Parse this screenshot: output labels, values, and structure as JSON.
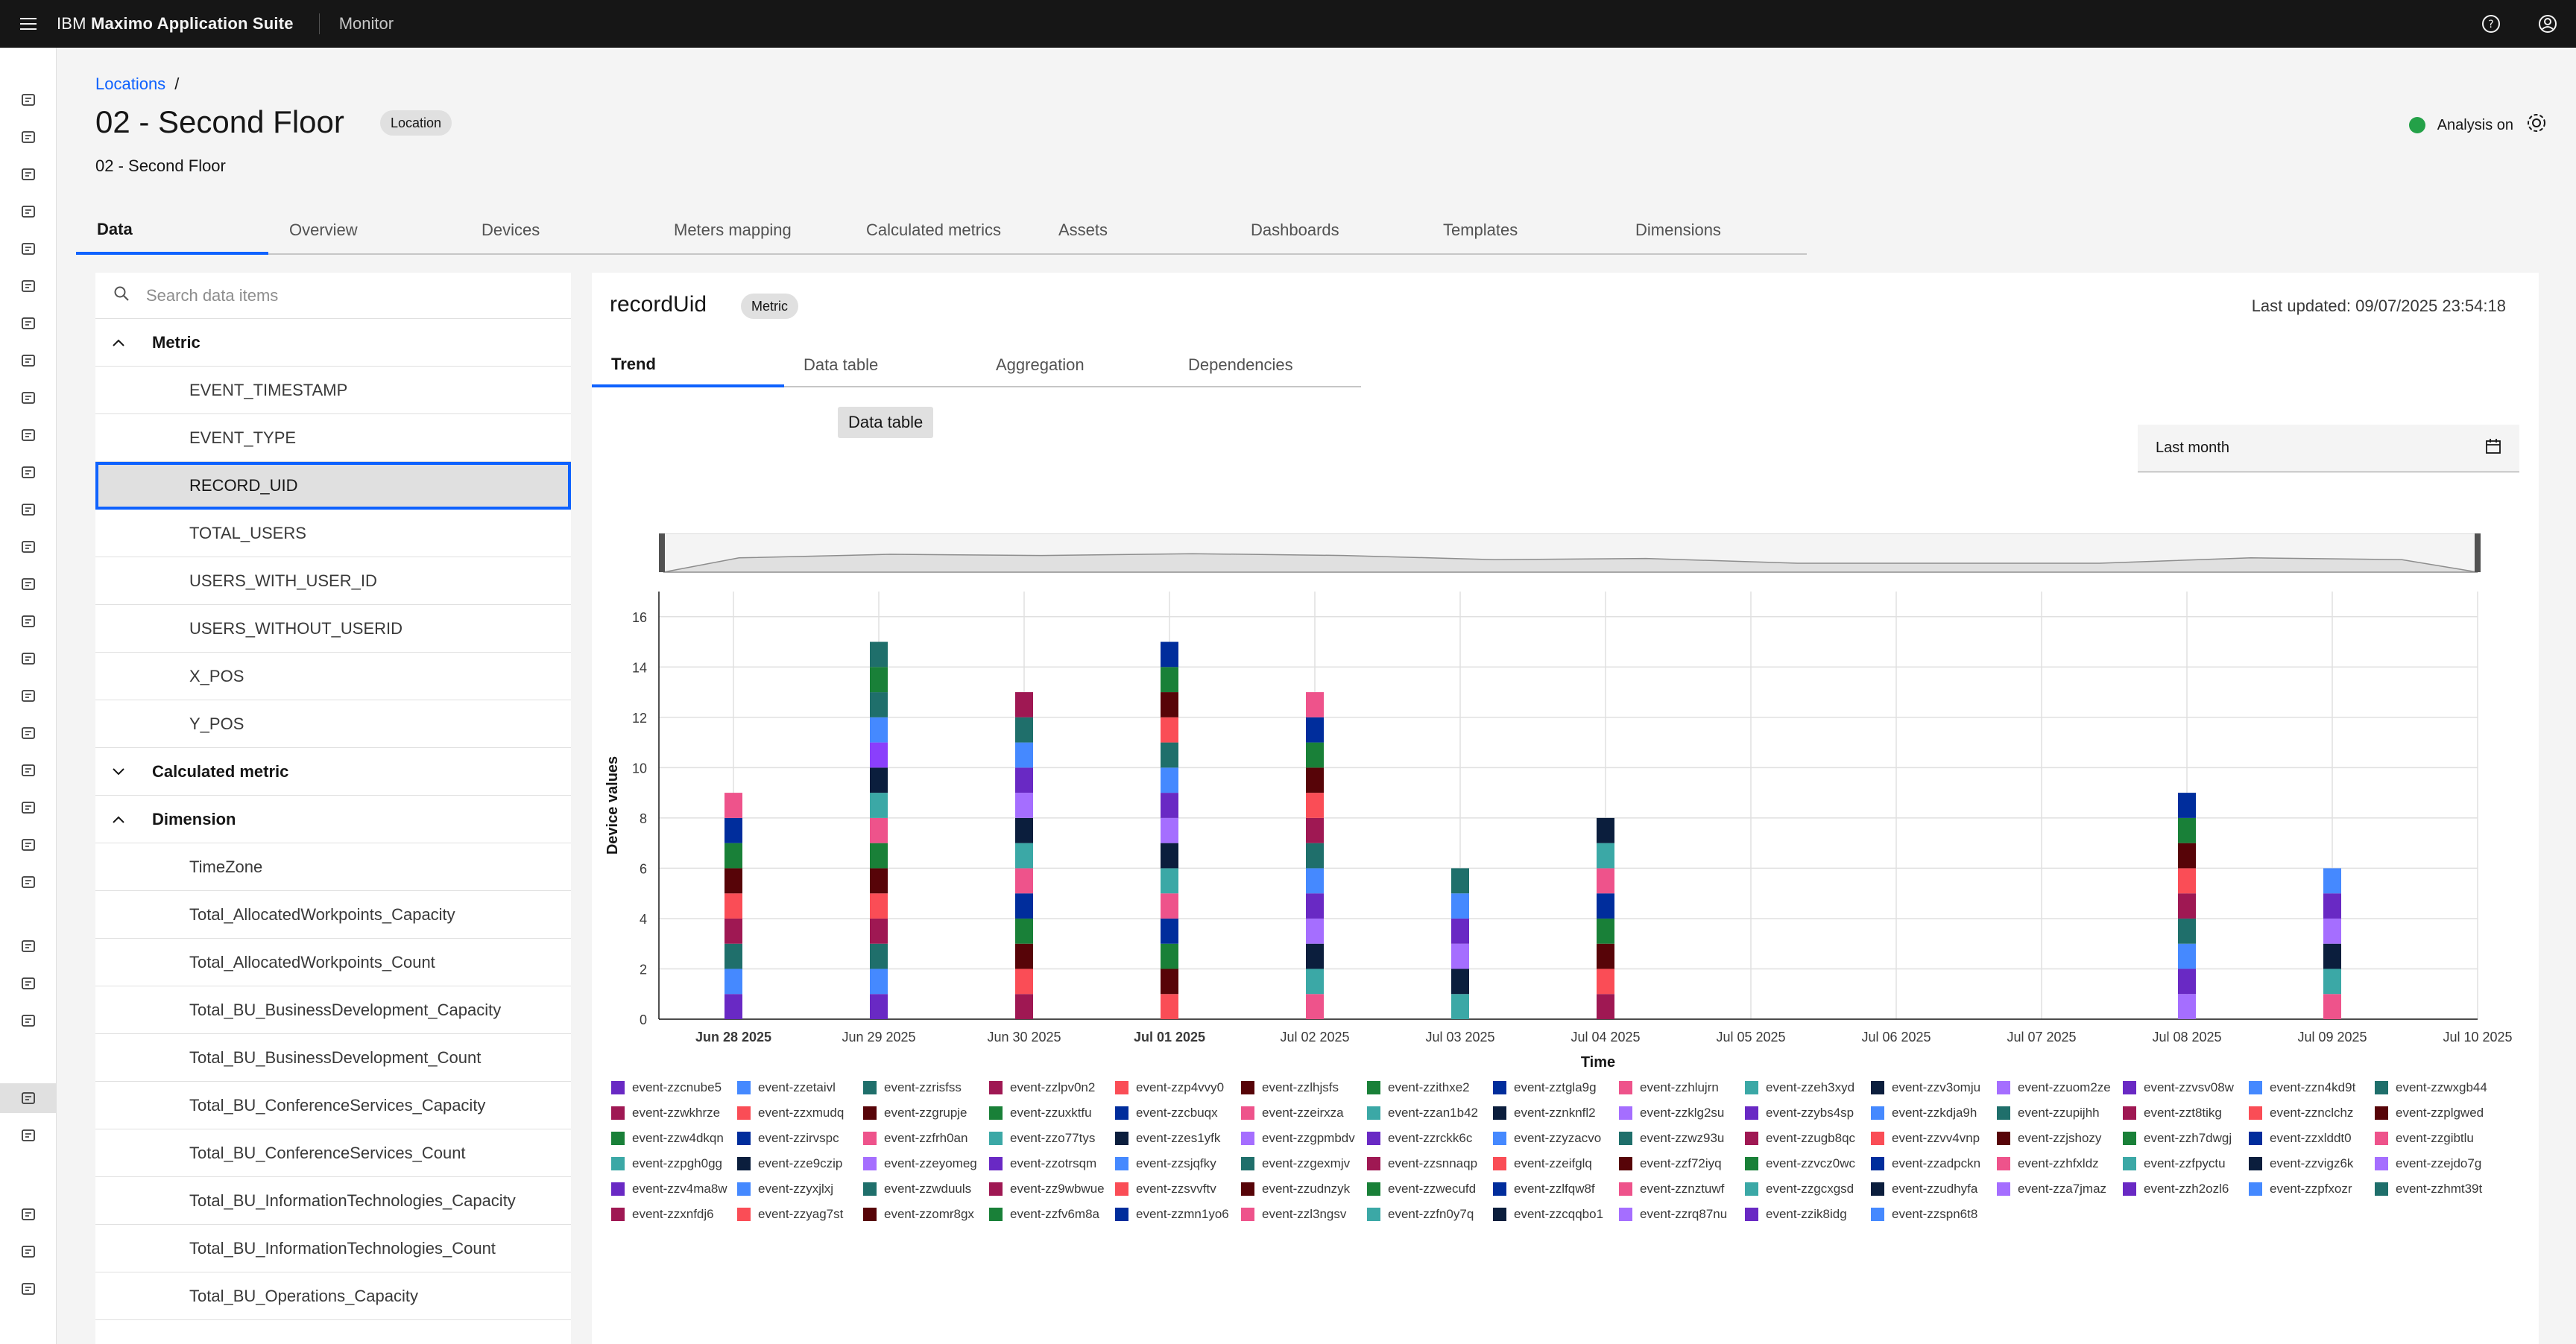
{
  "header": {
    "brand_prefix": "IBM ",
    "brand_name": "Maximo Application Suite",
    "app_name": "Monitor",
    "menu_icon": "hamburger-icon",
    "help_icon": "help-icon",
    "user_icon": "user-avatar-icon"
  },
  "sidenav": {
    "icons": [
      "user-icon",
      "bar-chart-icon",
      "rocket-icon",
      "tree-icon",
      "clipboard-check-icon",
      "report-icon",
      "line-chart-icon",
      "monitor-icon",
      "grid-icon",
      "briefcase-icon",
      "network-icon",
      "dashboard-icon",
      "shield-icon",
      "checklist-icon",
      "clipboard-icon",
      "lock-icon",
      "cart-icon",
      "handshake-icon",
      "hierarchy-icon",
      "sliders-icon",
      "task-icon",
      "document-icon",
      "list-check-icon",
      "gauge-icon",
      "org-chart-icon",
      "table-icon",
      "data-structure-icon",
      "phone-icon",
      "settings-alert-icon",
      "settings-icon"
    ],
    "active_index": 25
  },
  "page": {
    "breadcrumb": "Locations",
    "breadcrumb_sep": "/",
    "title": "02 - Second Floor",
    "title_tag": "Location",
    "subtitle": "02 - Second Floor",
    "analysis_label": "Analysis on",
    "tabs": [
      "Data",
      "Overview",
      "Devices",
      "Meters mapping",
      "Calculated metrics",
      "Assets",
      "Dashboards",
      "Templates",
      "Dimensions"
    ]
  },
  "left": {
    "search_placeholder": "Search data items",
    "groups": [
      {
        "label": "Metric",
        "expanded": true,
        "items": [
          "EVENT_TIMESTAMP",
          "EVENT_TYPE",
          "RECORD_UID",
          "TOTAL_USERS",
          "USERS_WITH_USER_ID",
          "USERS_WITHOUT_USERID",
          "X_POS",
          "Y_POS"
        ]
      },
      {
        "label": "Calculated metric",
        "expanded": false,
        "items": []
      },
      {
        "label": "Dimension",
        "expanded": true,
        "items": [
          "TimeZone",
          "Total_AllocatedWorkpoints_Capacity",
          "Total_AllocatedWorkpoints_Count",
          "Total_BU_BusinessDevelopment_Capacity",
          "Total_BU_BusinessDevelopment_Count",
          "Total_BU_ConferenceServices_Capacity",
          "Total_BU_ConferenceServices_Count",
          "Total_BU_InformationTechnologies_Capacity",
          "Total_BU_InformationTechnologies_Count",
          "Total_BU_Operations_Capacity"
        ]
      }
    ],
    "selected": "RECORD_UID"
  },
  "right": {
    "title": "recordUid",
    "tag": "Metric",
    "last_updated": "Last updated: 09/07/2025 23:54:18",
    "subtabs": [
      "Trend",
      "Data table",
      "Aggregation",
      "Dependencies"
    ],
    "tooltip": "Data table",
    "date_range": "Last month"
  },
  "chart_data": {
    "type": "bar",
    "stacked": true,
    "xlabel": "Time",
    "ylabel": "Device values",
    "ylim": [
      0,
      17
    ],
    "y_ticks": [
      0,
      2,
      4,
      6,
      8,
      10,
      12,
      14,
      16
    ],
    "x_ticks": [
      "Jun 28 2025",
      "Jun 29 2025",
      "Jun 30 2025",
      "Jul 01 2025",
      "Jul 02 2025",
      "Jul 03 2025",
      "Jul 04 2025",
      "Jul 05 2025",
      "Jul 06 2025",
      "Jul 07 2025",
      "Jul 08 2025",
      "Jul 09 2025",
      "Jul 10 2025"
    ],
    "bold_ticks": [
      "Jun 28 2025",
      "Jul 01 2025"
    ],
    "categories": [
      "Jun 28 2025",
      "Jun 29 2025",
      "Jun 30 2025",
      "Jul 01 2025",
      "Jul 02 2025",
      "Jul 03 2025",
      "Jul 04 2025",
      "Jul 05 2025",
      "Jul 06 2025",
      "Jul 07 2025",
      "Jul 08 2025",
      "Jul 09 2025"
    ],
    "totals": [
      9,
      15,
      13,
      16,
      13,
      6,
      8,
      0,
      0,
      0,
      9,
      6
    ],
    "segment_colors": [
      [
        "#6929c4",
        "#4589ff",
        "#1f6f6b",
        "#9f1853",
        "#fa4d56",
        "#570408",
        "#198038",
        "#002d9c",
        "#ee538b"
      ],
      [
        "#6929c4",
        "#4589ff",
        "#1f6f6b",
        "#9f1853",
        "#fa4d56",
        "#570408",
        "#198038",
        "#ee538b",
        "#3ba8a6",
        "#0b1e3d",
        "#8a3ffc",
        "#4589ff",
        "#1f6f6b",
        "#198038",
        "#1f6f6b"
      ],
      [
        "#9f1853",
        "#fa4d56",
        "#570408",
        "#198038",
        "#002d9c",
        "#ee538b",
        "#3ba8a6",
        "#0b1e3d",
        "#a56eff",
        "#6929c4",
        "#4589ff",
        "#1f6f6b",
        "#9f1853"
      ],
      [
        "#fa4d56",
        "#570408",
        "#198038",
        "#002d9c",
        "#ee538b",
        "#3ba8a6",
        "#0b1e3d",
        "#a56eff",
        "#6929c4",
        "#4589ff",
        "#1f6f6b",
        "#fa4d56",
        "#570408",
        "#198038",
        "#002d9c"
      ],
      [
        "#ee538b",
        "#3ba8a6",
        "#0b1e3d",
        "#a56eff",
        "#6929c4",
        "#4589ff",
        "#1f6f6b",
        "#9f1853",
        "#fa4d56",
        "#570408",
        "#198038",
        "#002d9c",
        "#ee538b"
      ],
      [
        "#3ba8a6",
        "#0b1e3d",
        "#a56eff",
        "#6929c4",
        "#4589ff",
        "#1f6f6b"
      ],
      [
        "#9f1853",
        "#fa4d56",
        "#570408",
        "#198038",
        "#002d9c",
        "#ee538b",
        "#3ba8a6",
        "#0b1e3d"
      ],
      [],
      [],
      [],
      [
        "#a56eff",
        "#6929c4",
        "#4589ff",
        "#1f6f6b",
        "#9f1853",
        "#fa4d56",
        "#570408",
        "#198038",
        "#002d9c"
      ],
      [
        "#ee538b",
        "#3ba8a6",
        "#0b1e3d",
        "#a56eff",
        "#6929c4",
        "#4589ff"
      ]
    ],
    "legend": [
      {
        "name": "event-zzcnube5",
        "color": "#6929c4"
      },
      {
        "name": "event-zzetaivl",
        "color": "#4589ff"
      },
      {
        "name": "event-zzrisfss",
        "color": "#1f6f6b"
      },
      {
        "name": "event-zzlpv0n2",
        "color": "#9f1853"
      },
      {
        "name": "event-zzp4vvy0",
        "color": "#fa4d56"
      },
      {
        "name": "event-zzlhjsfs",
        "color": "#570408"
      },
      {
        "name": "event-zzithxe2",
        "color": "#198038"
      },
      {
        "name": "event-zztgla9g",
        "color": "#002d9c"
      },
      {
        "name": "event-zzhlujrn",
        "color": "#ee538b"
      },
      {
        "name": "event-zzeh3xyd",
        "color": "#3ba8a6"
      },
      {
        "name": "event-zzv3omju",
        "color": "#0b1e3d"
      },
      {
        "name": "event-zzuom2ze",
        "color": "#a56eff"
      },
      {
        "name": "event-zzvsv08w",
        "color": "#6929c4"
      },
      {
        "name": "event-zzn4kd9t",
        "color": "#4589ff"
      },
      {
        "name": "event-zzwxgb44",
        "color": "#1f6f6b"
      },
      {
        "name": "event-zzwkhrze",
        "color": "#9f1853"
      },
      {
        "name": "event-zzxmudq",
        "color": "#fa4d56"
      },
      {
        "name": "event-zzgrupje",
        "color": "#570408"
      },
      {
        "name": "event-zzuxktfu",
        "color": "#198038"
      },
      {
        "name": "event-zzcbuqx",
        "color": "#002d9c"
      },
      {
        "name": "event-zzeirxza",
        "color": "#ee538b"
      },
      {
        "name": "event-zzan1b42",
        "color": "#3ba8a6"
      },
      {
        "name": "event-zznknfl2",
        "color": "#0b1e3d"
      },
      {
        "name": "event-zzklg2su",
        "color": "#a56eff"
      },
      {
        "name": "event-zzybs4sp",
        "color": "#6929c4"
      },
      {
        "name": "event-zzkdja9h",
        "color": "#4589ff"
      },
      {
        "name": "event-zzupijhh",
        "color": "#1f6f6b"
      },
      {
        "name": "event-zzt8tikg",
        "color": "#9f1853"
      },
      {
        "name": "event-zznclchz",
        "color": "#fa4d56"
      },
      {
        "name": "event-zzplgwed",
        "color": "#570408"
      },
      {
        "name": "event-zzw4dkqn",
        "color": "#198038"
      },
      {
        "name": "event-zzirvspc",
        "color": "#002d9c"
      },
      {
        "name": "event-zzfrh0an",
        "color": "#ee538b"
      },
      {
        "name": "event-zzo77tys",
        "color": "#3ba8a6"
      },
      {
        "name": "event-zzes1yfk",
        "color": "#0b1e3d"
      },
      {
        "name": "event-zzgpmbdv",
        "color": "#a56eff"
      },
      {
        "name": "event-zzrckk6c",
        "color": "#6929c4"
      },
      {
        "name": "event-zzyzacvo",
        "color": "#4589ff"
      },
      {
        "name": "event-zzwz93u",
        "color": "#1f6f6b"
      },
      {
        "name": "event-zzugb8qc",
        "color": "#9f1853"
      },
      {
        "name": "event-zzvv4vnp",
        "color": "#fa4d56"
      },
      {
        "name": "event-zzjshozy",
        "color": "#570408"
      },
      {
        "name": "event-zzh7dwgj",
        "color": "#198038"
      },
      {
        "name": "event-zzxlddt0",
        "color": "#002d9c"
      },
      {
        "name": "event-zzgibtlu",
        "color": "#ee538b"
      },
      {
        "name": "event-zzpgh0gg",
        "color": "#3ba8a6"
      },
      {
        "name": "event-zze9czip",
        "color": "#0b1e3d"
      },
      {
        "name": "event-zzeyomeg",
        "color": "#a56eff"
      },
      {
        "name": "event-zzotrsqm",
        "color": "#6929c4"
      },
      {
        "name": "event-zzsjqfky",
        "color": "#4589ff"
      },
      {
        "name": "event-zzgexmjv",
        "color": "#1f6f6b"
      },
      {
        "name": "event-zzsnnaqp",
        "color": "#9f1853"
      },
      {
        "name": "event-zzeifglq",
        "color": "#fa4d56"
      },
      {
        "name": "event-zzf72iyq",
        "color": "#570408"
      },
      {
        "name": "event-zzvcz0wc",
        "color": "#198038"
      },
      {
        "name": "event-zzadpckn",
        "color": "#002d9c"
      },
      {
        "name": "event-zzhfxldz",
        "color": "#ee538b"
      },
      {
        "name": "event-zzfpyctu",
        "color": "#3ba8a6"
      },
      {
        "name": "event-zzvigz6k",
        "color": "#0b1e3d"
      },
      {
        "name": "event-zzejdo7g",
        "color": "#a56eff"
      },
      {
        "name": "event-zzv4ma8w",
        "color": "#6929c4"
      },
      {
        "name": "event-zzyxjlxj",
        "color": "#4589ff"
      },
      {
        "name": "event-zzwduuls",
        "color": "#1f6f6b"
      },
      {
        "name": "event-zz9wbwue",
        "color": "#9f1853"
      },
      {
        "name": "event-zzsvvftv",
        "color": "#fa4d56"
      },
      {
        "name": "event-zzudnzyk",
        "color": "#570408"
      },
      {
        "name": "event-zzwecufd",
        "color": "#198038"
      },
      {
        "name": "event-zzlfqw8f",
        "color": "#002d9c"
      },
      {
        "name": "event-zznztuwf",
        "color": "#ee538b"
      },
      {
        "name": "event-zzgcxgsd",
        "color": "#3ba8a6"
      },
      {
        "name": "event-zzudhyfa",
        "color": "#0b1e3d"
      },
      {
        "name": "event-zza7jmaz",
        "color": "#a56eff"
      },
      {
        "name": "event-zzh2ozl6",
        "color": "#6929c4"
      },
      {
        "name": "event-zzpfxozr",
        "color": "#4589ff"
      },
      {
        "name": "event-zzhmt39t",
        "color": "#1f6f6b"
      },
      {
        "name": "event-zzxnfdj6",
        "color": "#9f1853"
      },
      {
        "name": "event-zzyag7st",
        "color": "#fa4d56"
      },
      {
        "name": "event-zzomr8gx",
        "color": "#570408"
      },
      {
        "name": "event-zzfv6m8a",
        "color": "#198038"
      },
      {
        "name": "event-zzmn1yo6",
        "color": "#002d9c"
      },
      {
        "name": "event-zzl3ngsv",
        "color": "#ee538b"
      },
      {
        "name": "event-zzfn0y7q",
        "color": "#3ba8a6"
      },
      {
        "name": "event-zzcqqbo1",
        "color": "#0b1e3d"
      },
      {
        "name": "event-zzrq87nu",
        "color": "#a56eff"
      },
      {
        "name": "event-zzik8idg",
        "color": "#6929c4"
      },
      {
        "name": "event-zzspn6t8",
        "color": "#4589ff"
      }
    ]
  }
}
